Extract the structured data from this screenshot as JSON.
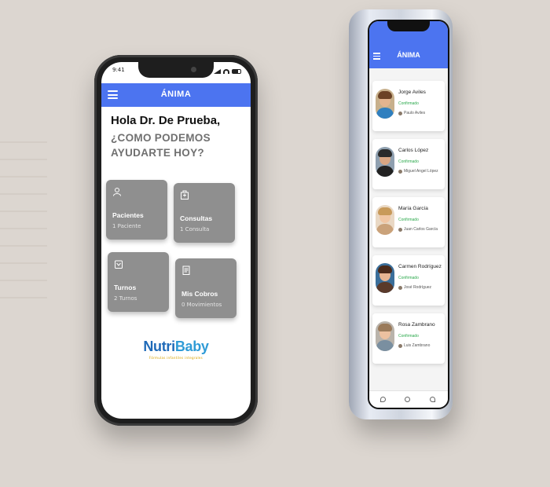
{
  "background": {
    "color": "#dcd6d0"
  },
  "phone1": {
    "status_time": "9:41",
    "app_title": "ÁNIMA",
    "accent": "#4c74f0",
    "greeting": "Hola Dr. De Prueba,",
    "question_line1": "¿COMO PODEMOS",
    "question_line2": "AYUDARTE HOY?",
    "tiles": [
      {
        "label": "Pacientes",
        "sub": "1 Paciente",
        "icon": "patient-icon"
      },
      {
        "label": "Consultas",
        "sub": "1 Consulta",
        "icon": "hospital-icon"
      },
      {
        "label": "Turnos",
        "sub": "2 Turnos",
        "icon": "calendar-icon"
      },
      {
        "label": "Mis Cobros",
        "sub": "0 Movimientos",
        "icon": "receipt-icon"
      }
    ],
    "brand": {
      "name_part1": "Nutri",
      "name_part2": "Baby",
      "tagline": "Fórmulas infantiles integrales"
    }
  },
  "phone2": {
    "app_title": "ÁNIMA",
    "accent": "#4c74f0",
    "patients": [
      {
        "name": "Jorge  Aviles",
        "status": "Confirmado",
        "doctor": "Paulo Aviles"
      },
      {
        "name": "Carlos López",
        "status": "Confirmado",
        "doctor": "Miguel Angel López"
      },
      {
        "name": "María García",
        "status": "Confirmado",
        "doctor": "Juan Carlos García"
      },
      {
        "name": "Carmen  Rodríguez",
        "status": "Confirmado",
        "doctor": "José  Rodríguez"
      },
      {
        "name": "Rosa Zambrano",
        "status": "Confirmado",
        "doctor": "Luis Zambrano"
      }
    ],
    "status_color": "#29a84a"
  }
}
